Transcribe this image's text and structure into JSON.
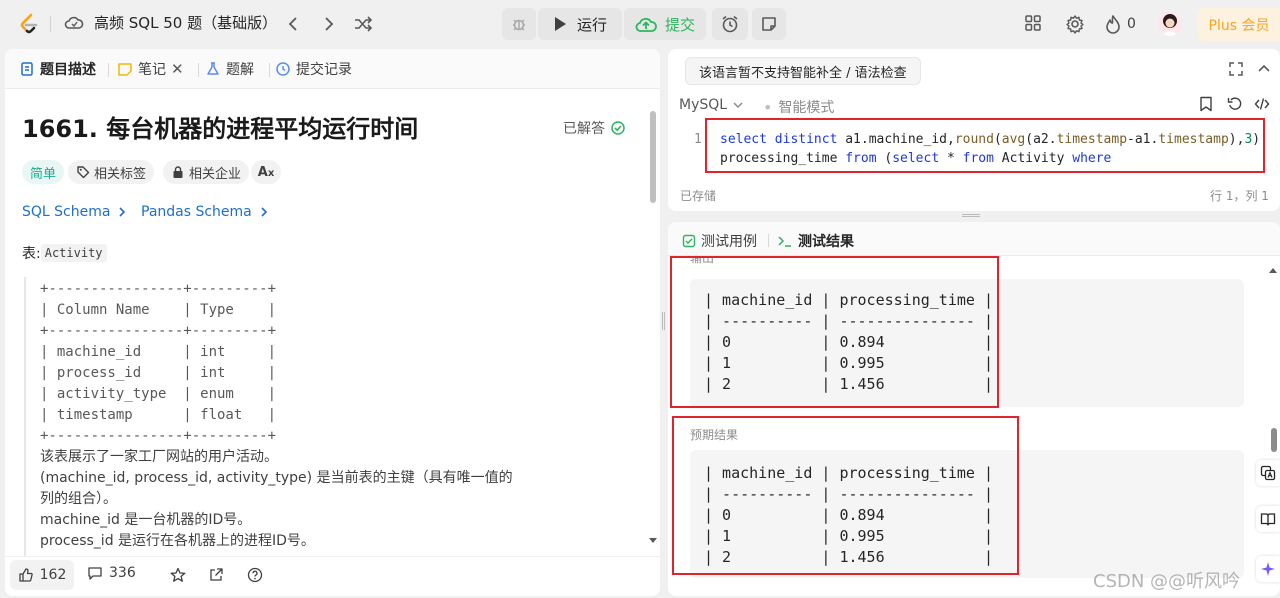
{
  "topbar": {
    "title": "高频 SQL 50 题（基础版）",
    "run_label": "运行",
    "submit_label": "提交",
    "points": "0",
    "plus_label": "Plus 会员"
  },
  "left": {
    "tabs": [
      "题目描述",
      "笔记",
      "题解",
      "提交记录"
    ],
    "problem_title": "1661. 每台机器的进程平均运行时间",
    "solved_label": "已解答",
    "tags": [
      "简单",
      "相关标签",
      "相关企业"
    ],
    "schema_links": [
      "SQL Schema",
      "Pandas Schema"
    ],
    "table_prefix": "表: ",
    "table_name": "Activity",
    "table_ascii": "+----------------+---------+\n| Column Name    | Type    |\n+----------------+---------+\n| machine_id     | int     |\n| process_id     | int     |\n| activity_type  | enum    |\n| timestamp      | float   |\n+----------------+---------+",
    "desc_lines": [
      "该表展示了一家工厂网站的用户活动。",
      "(machine_id, process_id, activity_type) 是当前表的主键（具有唯一值的",
      "列的组合）。",
      "machine_id 是一台机器的ID号。",
      "process_id 是运行在各机器上的进程ID号。"
    ],
    "likes": "162",
    "comments": "336"
  },
  "editor": {
    "tooltip": "该语言暂不支持智能补全 / 语法检查",
    "language": "MySQL",
    "smart_mode": "智能模式",
    "line_no": "1",
    "code_line1": "select distinct a1.machine_id,round(avg(a2.timestamp-a1.timestamp),3)",
    "code_line2": "processing_time from (select * from Activity where",
    "saved": "已存储",
    "cursor": "行 1，列 1"
  },
  "results": {
    "tabs": [
      "测试用例",
      "测试结果"
    ],
    "output_label": "输出",
    "output_table": "| machine_id | processing_time |\n| ---------- | --------------- |\n| 0          | 0.894           |\n| 1          | 0.995           |\n| 2          | 1.456           |",
    "expected_label": "预期结果",
    "expected_table": "| machine_id | processing_time |\n| ---------- | --------------- |\n| 0          | 0.894           |\n| 1          | 0.995           |\n| 2          | 1.456           |"
  },
  "watermark": "CSDN @@听风吟",
  "colors": {
    "accent_green": "#2db55d",
    "accent_blue": "#1e6fc9",
    "highlight_red": "#e0242d",
    "plus_gold": "#f5a623"
  }
}
